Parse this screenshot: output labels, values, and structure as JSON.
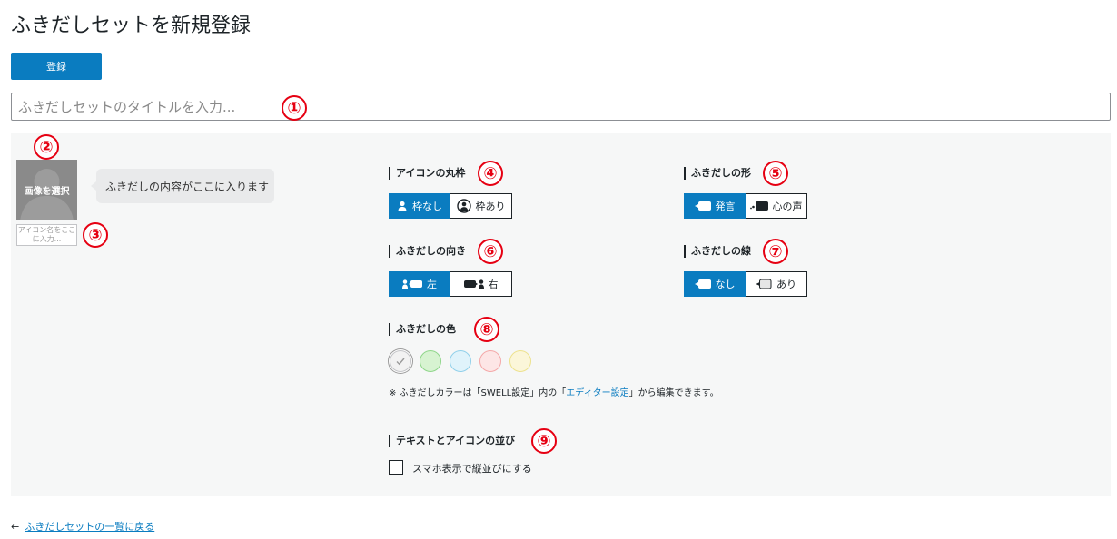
{
  "page": {
    "title": "ふきだしセットを新規登録"
  },
  "actions": {
    "register_label": "登録"
  },
  "title_input": {
    "placeholder": "ふきだしセットのタイトルを入力..."
  },
  "markers": [
    "①",
    "②",
    "③",
    "④",
    "⑤",
    "⑥",
    "⑦",
    "⑧",
    "⑨"
  ],
  "preview": {
    "avatar_label": "画像を選択",
    "name_placeholder": "アイコン名をここに入力...",
    "bubble_text": "ふきだしの内容がここに入ります"
  },
  "icon_frame": {
    "label": "アイコンの丸枠",
    "options": [
      "枠なし",
      "枠あり"
    ],
    "selected": "枠なし"
  },
  "bubble_shape": {
    "label": "ふきだしの形",
    "options": [
      "発言",
      "心の声"
    ],
    "selected": "発言"
  },
  "bubble_direction": {
    "label": "ふきだしの向き",
    "options": [
      "左",
      "右"
    ],
    "selected": "左"
  },
  "bubble_border": {
    "label": "ふきだしの線",
    "options": [
      "なし",
      "あり"
    ],
    "selected": "なし"
  },
  "bubble_color": {
    "label": "ふきだしの色",
    "swatches": [
      {
        "name": "default",
        "color": "#f2f2f2",
        "border": "#c3c4c7",
        "selected": true
      },
      {
        "name": "green",
        "color": "#d7f3d1",
        "border": "#8fd68a"
      },
      {
        "name": "blue",
        "color": "#e0f3fb",
        "border": "#91d0ea"
      },
      {
        "name": "red",
        "color": "#fde6e6",
        "border": "#f4a8a8"
      },
      {
        "name": "yellow",
        "color": "#fbf6d9",
        "border": "#ede28e"
      }
    ],
    "note_prefix": "※ ふきだしカラーは「SWELL設定」内の「",
    "note_link": "エディター設定",
    "note_suffix": "」から編集できます。"
  },
  "layout_option": {
    "label": "テキストとアイコンの並び",
    "checkbox_label": "スマホ表示で縦並びにする",
    "checked": false
  },
  "footer": {
    "arrow": "←",
    "back_link": "ふきだしセットの一覧に戻る"
  },
  "colors": {
    "accent": "#0a7cc0",
    "marker": "#e60012"
  }
}
